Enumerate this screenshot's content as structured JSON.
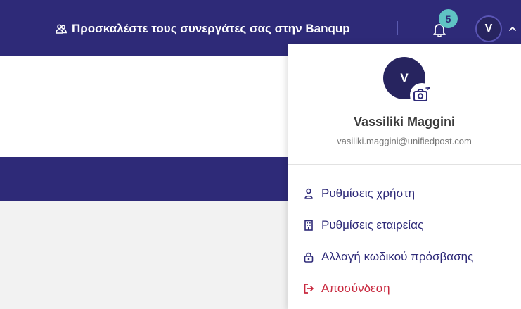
{
  "header": {
    "invite_text": "Προσκαλέστε τους συνεργάτες σας στην Banqup",
    "notification_count": "5",
    "avatar_initial": "V"
  },
  "profile": {
    "avatar_initial": "V",
    "name": "Vassiliki Maggini",
    "email": "vasiliki.maggini@unifiedpost.com"
  },
  "menu": {
    "items": [
      {
        "label": "Ρυθμίσεις χρήστη",
        "icon": "user-icon"
      },
      {
        "label": "Ρυθμίσεις εταιρείας",
        "icon": "building-icon"
      },
      {
        "label": "Αλλαγή κωδικού πρόσβασης",
        "icon": "lock-icon"
      },
      {
        "label": "Αποσύνδεση",
        "icon": "logout-icon"
      }
    ]
  },
  "colors": {
    "brand_navy": "#2e2a78",
    "badge_teal": "#5fc3c4",
    "logout_red": "#c8283e"
  }
}
